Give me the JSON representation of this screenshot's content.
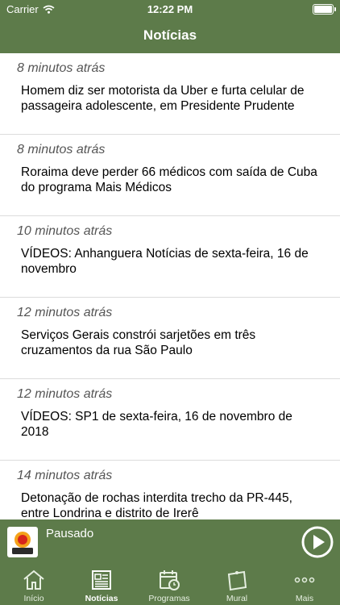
{
  "status_bar": {
    "carrier": "Carrier",
    "time": "12:22 PM"
  },
  "header": {
    "title": "Notícias"
  },
  "news": [
    {
      "time_ago": "8 minutos atrás",
      "headline": "Homem diz ser motorista da Uber e furta celular de passageira adolescente, em Presidente Prudente"
    },
    {
      "time_ago": "8 minutos atrás",
      "headline": "Roraima deve perder 66 médicos com saída de Cuba do programa Mais Médicos"
    },
    {
      "time_ago": "10 minutos atrás",
      "headline": "VÍDEOS: Anhanguera Notícias de sexta-feira, 16 de novembro"
    },
    {
      "time_ago": "12 minutos atrás",
      "headline": "Serviços Gerais constrói sarjetões em três cruzamentos da rua São Paulo"
    },
    {
      "time_ago": "12 minutos atrás",
      "headline": "VÍDEOS: SP1 de sexta-feira, 16 de novembro de 2018"
    },
    {
      "time_ago": "14 minutos atrás",
      "headline": "Detonação de rochas interdita trecho da PR-445, entre Londrina e distrito de Irerê"
    }
  ],
  "player": {
    "status": "Pausado",
    "logo_text": "108 FM"
  },
  "tabs": [
    {
      "label": "Início",
      "icon": "home-icon"
    },
    {
      "label": "Notícias",
      "icon": "newspaper-icon"
    },
    {
      "label": "Programas",
      "icon": "calendar-icon"
    },
    {
      "label": "Mural",
      "icon": "board-icon"
    },
    {
      "label": "Mais",
      "icon": "more-icon"
    }
  ],
  "colors": {
    "brand_green": "#5d7b4a"
  }
}
